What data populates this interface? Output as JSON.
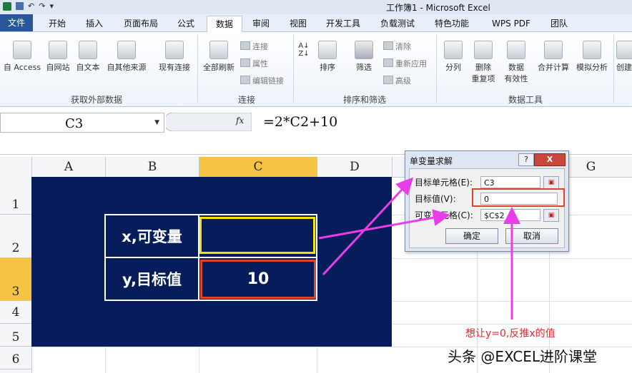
{
  "title_bar": {
    "text": "工作簿1 - Microsoft Excel"
  },
  "tabs": [
    {
      "label": "文件"
    },
    {
      "label": "开始"
    },
    {
      "label": "插入"
    },
    {
      "label": "页面布局"
    },
    {
      "label": "公式"
    },
    {
      "label": "数据"
    },
    {
      "label": "审阅"
    },
    {
      "label": "视图"
    },
    {
      "label": "开发工具"
    },
    {
      "label": "负载测试"
    },
    {
      "label": "特色功能"
    },
    {
      "label": "WPS PDF"
    },
    {
      "label": "团队"
    }
  ],
  "ribbon": {
    "get_external": {
      "from_access": "自 Access",
      "from_web": "自网站",
      "from_text": "自文本",
      "from_other": "自其他来源",
      "existing": "现有连接",
      "group": "获取外部数据"
    },
    "connections": {
      "refresh_all": "全部刷新",
      "connections": "连接",
      "properties": "属性",
      "edit_links": "编辑链接",
      "group": "连接"
    },
    "sort_filter": {
      "sort": "排序",
      "filter": "筛选",
      "clear": "清除",
      "reapply": "重新应用",
      "advanced": "高级",
      "group": "排序和筛选"
    },
    "data_tools": {
      "split": "分列",
      "remove_dup_1": "删除",
      "remove_dup_2": "重复项",
      "validation_1": "数据",
      "validation_2": "有效性",
      "consolidate": "合并计算",
      "whatif": "模拟分析",
      "create": "创建",
      "group": "数据工具"
    }
  },
  "formula_bar": {
    "name_box": "C3",
    "fx": "fx",
    "formula": "=2*C2+10"
  },
  "columns": [
    "A",
    "B",
    "C",
    "D",
    "E",
    "F",
    "G"
  ],
  "rows": [
    "1",
    "2",
    "3",
    "4",
    "5",
    "6"
  ],
  "selected_column": "C",
  "selected_row": "3",
  "table": {
    "x_label": "x,可变量",
    "x_value": "",
    "y_label": "y,目标值",
    "y_value": "10"
  },
  "dialog": {
    "title": "单变量求解",
    "help": "?",
    "close": "X",
    "target_cell_label": "目标单元格(E):",
    "target_cell_value": "C3",
    "target_value_label": "目标值(V):",
    "target_value": "0",
    "changing_cell_label": "可变单元格(C):",
    "changing_cell_value": "$C$2",
    "ok": "确定",
    "cancel": "取消"
  },
  "annotation": "想让y=0,反推x的值",
  "watermark": "头条 @EXCEL进阶课堂",
  "colors": {
    "navy": "#061c5b",
    "highlight_red": "#e0432d",
    "highlight_yellow": "#f3e10a",
    "arrow_magenta": "#e83de8",
    "file_tab": "#2a579a"
  }
}
